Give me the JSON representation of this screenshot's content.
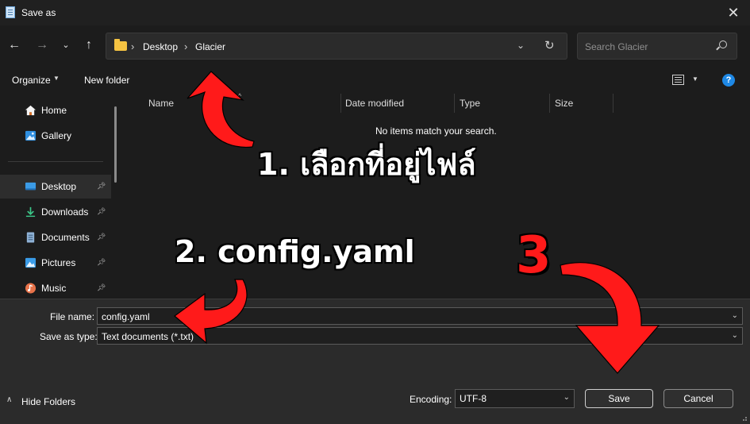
{
  "window": {
    "title": "Save as"
  },
  "address": {
    "crumbs": [
      "Desktop",
      "Glacier"
    ]
  },
  "search": {
    "placeholder": "Search Glacier"
  },
  "toolbar": {
    "organize": "Organize",
    "new_folder": "New folder"
  },
  "sidebar": {
    "items": [
      {
        "label": "Home",
        "icon": "home-icon"
      },
      {
        "label": "Gallery",
        "icon": "gallery-icon"
      },
      {
        "label": "Desktop",
        "icon": "desktop-icon",
        "pinned": true,
        "selected": true
      },
      {
        "label": "Downloads",
        "icon": "download-icon",
        "pinned": true
      },
      {
        "label": "Documents",
        "icon": "documents-icon",
        "pinned": true
      },
      {
        "label": "Pictures",
        "icon": "pictures-icon",
        "pinned": true
      },
      {
        "label": "Music",
        "icon": "music-icon",
        "pinned": true
      }
    ]
  },
  "columns": [
    "Name",
    "Date modified",
    "Type",
    "Size"
  ],
  "empty_message": "No items match your search.",
  "form": {
    "file_name_label": "File name:",
    "file_name_value": "config.yaml",
    "save_type_label": "Save as type:",
    "save_type_value": "Text documents (*.txt)",
    "encoding_label": "Encoding:",
    "encoding_value": "UTF-8"
  },
  "buttons": {
    "hide_folders": "Hide Folders",
    "save": "Save",
    "cancel": "Cancel"
  },
  "annotations": {
    "step1": "1.  เลือกที่อยู่ไฟล์",
    "step2": "2. config.yaml",
    "step3": "3",
    "arrow_color": "#ff1a1a"
  }
}
